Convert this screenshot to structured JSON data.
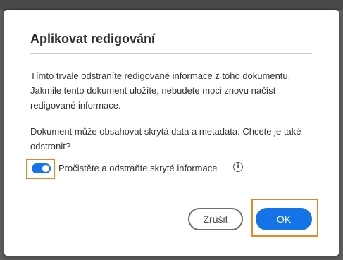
{
  "dialog": {
    "title": "Aplikovat redigování",
    "paragraph1": "Tímto trvale odstraníte redigované informace z toho dokumentu. Jakmile tento dokument uložíte, nebudete moci znovu načíst redigované informace.",
    "paragraph2": "Dokument může obsahovat skrytá data a metadata. Chcete je také odstranit?",
    "toggle": {
      "label": "Pročistěte a odstraňte skryté informace",
      "checked": true
    },
    "info_icon_glyph": "i",
    "buttons": {
      "cancel_label": "Zrušit",
      "ok_label": "OK"
    }
  },
  "colors": {
    "accent": "#1473e6",
    "highlight": "#e8862c"
  }
}
